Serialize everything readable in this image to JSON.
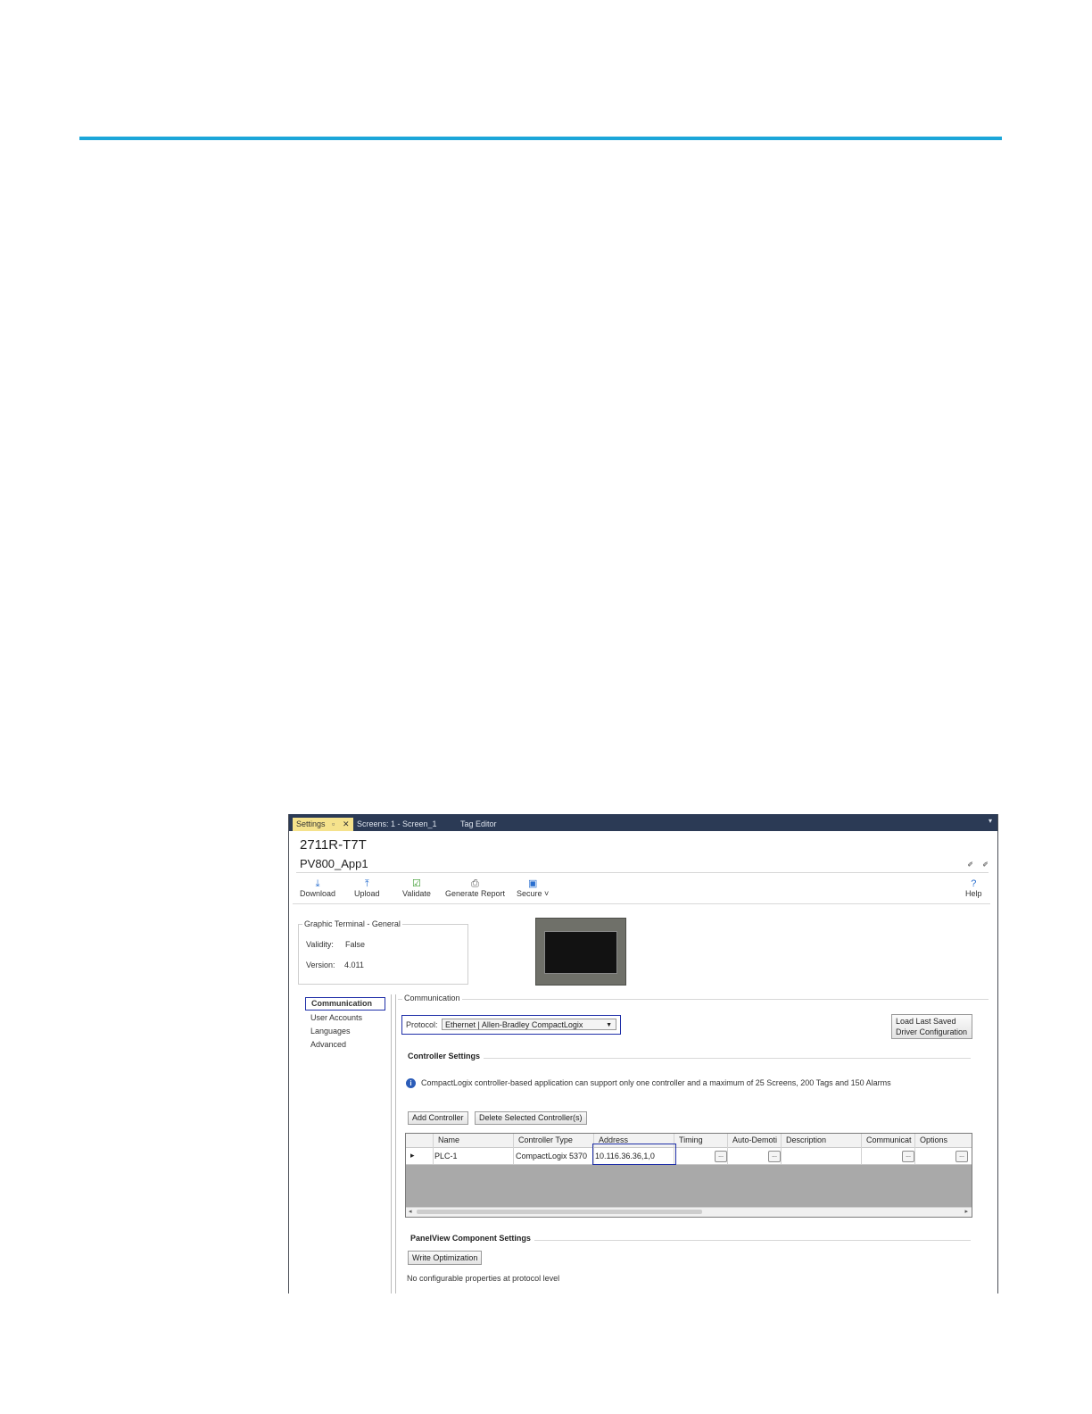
{
  "tabs": [
    {
      "label": "Settings",
      "pin": "▫",
      "close": "✕"
    },
    {
      "label": "Screens: 1 - Screen_1"
    },
    {
      "label": "Tag Editor"
    }
  ],
  "tab_dropdown": "▾",
  "header": {
    "model": "2711R-T7T",
    "app_name": "PV800_App1",
    "corner_icons": "✐ ✐"
  },
  "toolbar": {
    "download": "Download",
    "upload": "Upload",
    "validate": "Validate",
    "generate_report": "Generate Report",
    "secure": "Secure ˅",
    "help": "Help",
    "icons": {
      "download": "⤓",
      "upload": "⤒",
      "validate": "☑",
      "report": "⎙",
      "secure": "▣",
      "help": "?"
    }
  },
  "general": {
    "title": "Graphic Terminal - General",
    "validity_label": "Validity:",
    "validity_value": "False",
    "version_label": "Version:",
    "version_value": "4.011"
  },
  "nav": [
    "Communication",
    "User Accounts",
    "Languages",
    "Advanced"
  ],
  "communication": {
    "title": "Communication",
    "protocol_label": "Protocol:",
    "protocol_value": "Ethernet | Allen-Bradley CompactLogix",
    "load_saved_line1": "Load Last Saved",
    "load_saved_line2": "Driver Configuration",
    "controller_settings": "Controller Settings",
    "info": "CompactLogix controller-based application can support only one controller and a maximum of 25 Screens, 200 Tags and 150 Alarms",
    "info_icon": "i",
    "add_controller": "Add Controller",
    "delete_controllers": "Delete Selected Controller(s)",
    "columns": [
      "Name",
      "Controller Type",
      "Address",
      "Timing",
      "Auto-Demoti",
      "Description",
      "Communicat",
      "Options"
    ],
    "row": {
      "indicator": "▸",
      "name": "PLC-1",
      "type": "CompactLogix 5370",
      "address": "10.116.36.36,1,0"
    },
    "ellipsis": "...",
    "scroll_left": "◂",
    "scroll_right": "▸",
    "panelview_settings": "PanelView Component Settings",
    "write_optimization": "Write Optimization",
    "no_props": "No configurable properties at protocol level"
  },
  "colors": {
    "rule": "#1ba6d9",
    "tab_strip": "#2b3a55",
    "active_tab": "#f5e28c",
    "highlight_box": "#1f2fa8"
  }
}
